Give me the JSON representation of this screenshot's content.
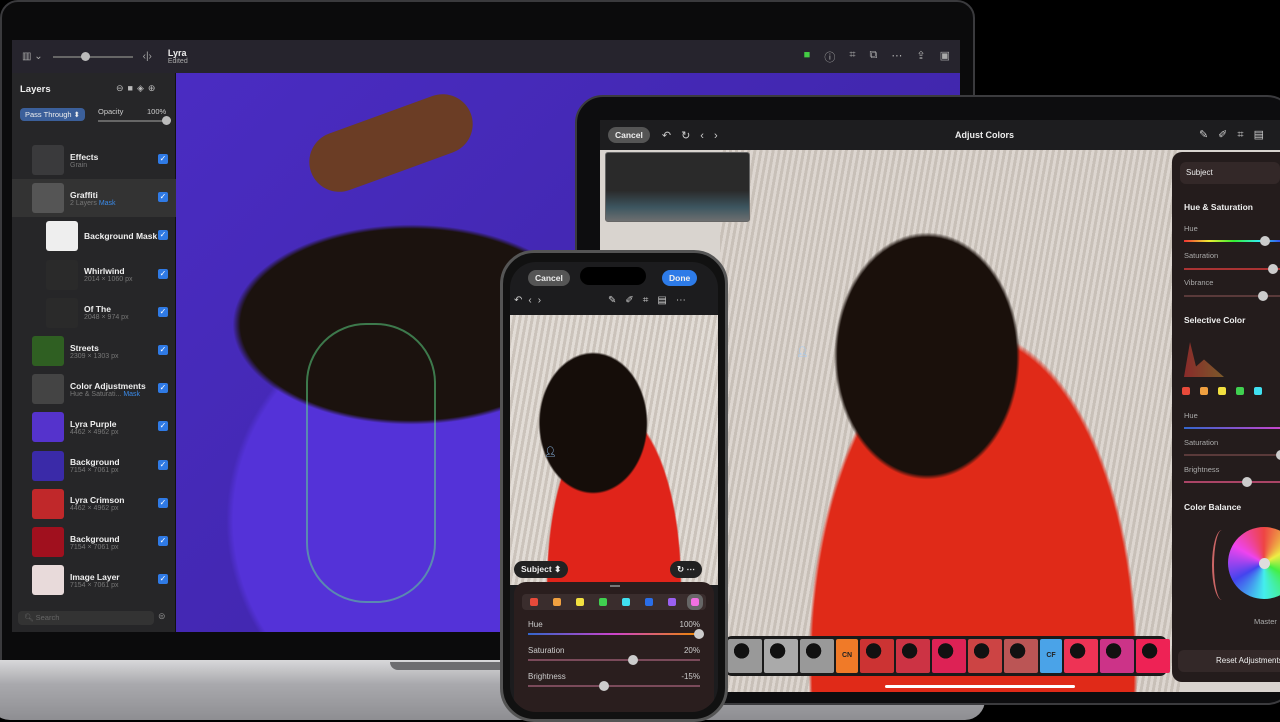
{
  "mac": {
    "doc_title": "Lyra",
    "doc_status": "Edited",
    "layers_title": "Layers",
    "blend_mode": "Pass Through",
    "opacity_label": "Opacity",
    "opacity_value": "100%",
    "layers": [
      {
        "name": "Effects",
        "sub": "Grain",
        "thumb": "#3a3a3c"
      },
      {
        "name": "Graffiti",
        "sub": "2 Layers",
        "mask": "Mask",
        "thumb": "#555"
      },
      {
        "name": "Background Mask",
        "sub": "",
        "thumb": "#eee"
      },
      {
        "name": "Whirlwind",
        "sub": "2014 × 1060 px",
        "thumb": "#2a2a2a"
      },
      {
        "name": "Of The",
        "sub": "2048 × 974 px",
        "thumb": "#2a2a2a"
      },
      {
        "name": "Streets",
        "sub": "2309 × 1303 px",
        "thumb": "#2f5f22"
      },
      {
        "name": "Color Adjustments",
        "sub": "Hue & Saturati...",
        "mask": "Mask",
        "thumb": "#444"
      },
      {
        "name": "Lyra Purple",
        "sub": "4462 × 4962 px",
        "thumb": "#5533cc"
      },
      {
        "name": "Background",
        "sub": "7154 × 7061 px",
        "thumb": "#3a2aa8"
      },
      {
        "name": "Lyra Crimson",
        "sub": "4462 × 4962 px",
        "thumb": "#c0282a"
      },
      {
        "name": "Background",
        "sub": "7154 × 7061 px",
        "thumb": "#a0101e"
      },
      {
        "name": "Image Layer",
        "sub": "7154 × 7061 px",
        "thumb": "#e8dada"
      }
    ],
    "search_placeholder": "Search"
  },
  "ipad": {
    "cancel": "Cancel",
    "title": "Adjust Colors",
    "subject": "Subject",
    "hue_sat": {
      "title": "Hue & Saturation",
      "hue": "Hue",
      "saturation": "Saturation",
      "vibrance": "Vibrance"
    },
    "selective": {
      "title": "Selective Color",
      "hue": "Hue",
      "saturation": "Saturation",
      "brightness": "Brightness"
    },
    "balance": {
      "title": "Color Balance",
      "wheel_label": "Master"
    },
    "reset": "Reset Adjustments",
    "film_badges": [
      "CN",
      "CF"
    ],
    "swatches": [
      "#e84a3a",
      "#f0a040",
      "#f2e040",
      "#40d050",
      "#40e0f0"
    ]
  },
  "iphone": {
    "cancel": "Cancel",
    "done": "Done",
    "subject": "Subject",
    "swatches": [
      "#e84a3a",
      "#f0a040",
      "#f2e040",
      "#40d050",
      "#40e0f0",
      "#2a6ee8",
      "#9a60f0",
      "#f070e0"
    ],
    "sliders": [
      {
        "label": "Hue",
        "value": "100%",
        "pos": 1.0
      },
      {
        "label": "Saturation",
        "value": "20%",
        "pos": 0.6
      },
      {
        "label": "Brightness",
        "value": "-15%",
        "pos": 0.425
      }
    ]
  }
}
